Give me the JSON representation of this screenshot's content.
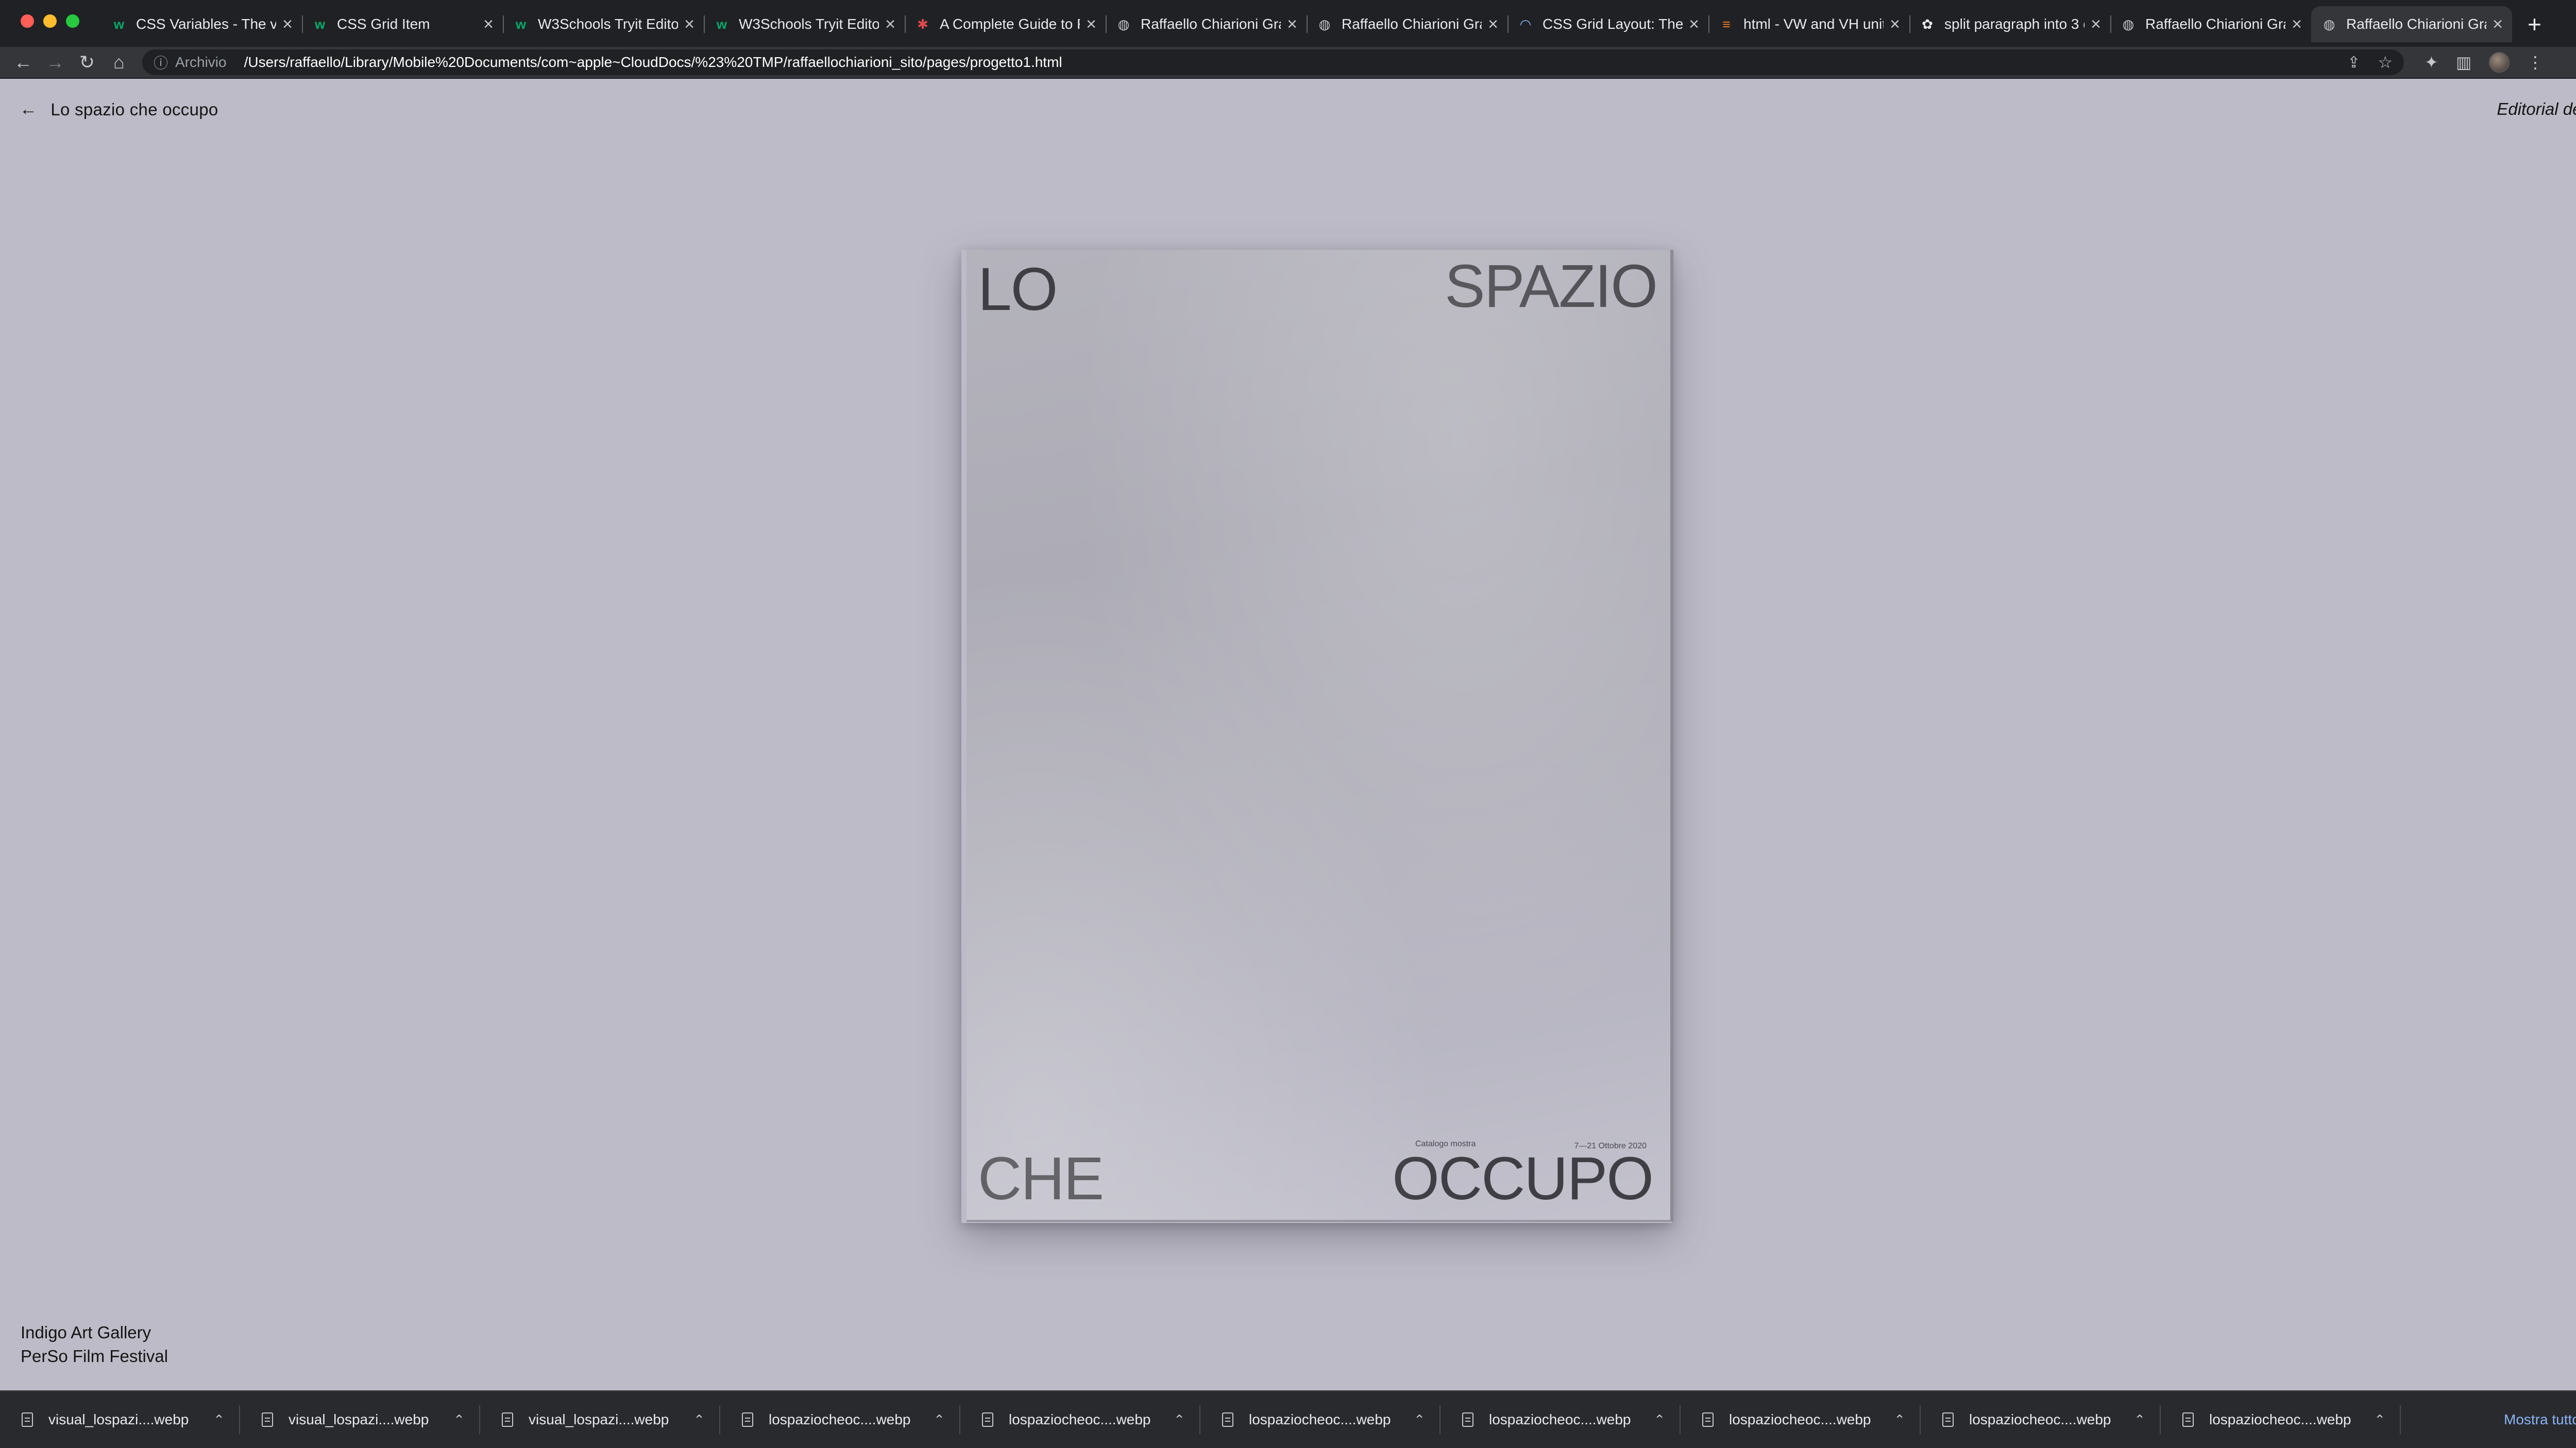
{
  "browser": {
    "tabs": [
      {
        "title": "CSS Variables - The va",
        "icon": "w3schools-icon",
        "active": false
      },
      {
        "title": "CSS Grid Item",
        "icon": "w3schools-icon",
        "active": false
      },
      {
        "title": "W3Schools Tryit Editor",
        "icon": "w3schools-icon",
        "active": false
      },
      {
        "title": "W3Schools Tryit Editor",
        "icon": "w3schools-icon",
        "active": false
      },
      {
        "title": "A Complete Guide to Fl",
        "icon": "css-tricks-icon",
        "active": false
      },
      {
        "title": "Raffaello Chiarioni Gra",
        "icon": "globe-icon",
        "active": false
      },
      {
        "title": "Raffaello Chiarioni Gra",
        "icon": "globe-icon",
        "active": false
      },
      {
        "title": "CSS Grid Layout: The F",
        "icon": "loading-icon",
        "active": false
      },
      {
        "title": "html - VW and VH unit",
        "icon": "stackoverflow-icon",
        "active": false
      },
      {
        "title": "split paragraph into 3 c",
        "icon": "chatgpt-icon",
        "active": false
      },
      {
        "title": "Raffaello Chiarioni Gra",
        "icon": "globe-icon",
        "active": false
      },
      {
        "title": "Raffaello Chiarioni Gra",
        "icon": "globe-icon",
        "active": true
      }
    ],
    "address": {
      "scheme_label": "Archivio",
      "url": "/Users/raffaello/Library/Mobile%20Documents/com~apple~CloudDocs/%23%20TMP/raffaellochiarioni_sito/pages/progetto1.html"
    }
  },
  "page": {
    "back_label": "Lo spazio che occupo",
    "category": "Editorial design",
    "credits": [
      "Indigo Art Gallery",
      "PerSo Film Festival"
    ],
    "year": "2020",
    "cover": {
      "top_left": "LO",
      "top_right": "SPAZIO",
      "bottom_left": "CHE",
      "bottom_right": "OCCUPO",
      "small_label": "Catalogo mostra",
      "small_date": "7—21 Ottobre 2020"
    }
  },
  "downloads": {
    "items": [
      "visual_lospazi....webp",
      "visual_lospazi....webp",
      "visual_lospazi....webp",
      "lospaziocheoc....webp",
      "lospaziocheoc....webp",
      "lospaziocheoc....webp",
      "lospaziocheoc....webp",
      "lospaziocheoc....webp",
      "lospaziocheoc....webp",
      "lospaziocheoc....webp"
    ],
    "show_all": "Mostra tutto"
  }
}
